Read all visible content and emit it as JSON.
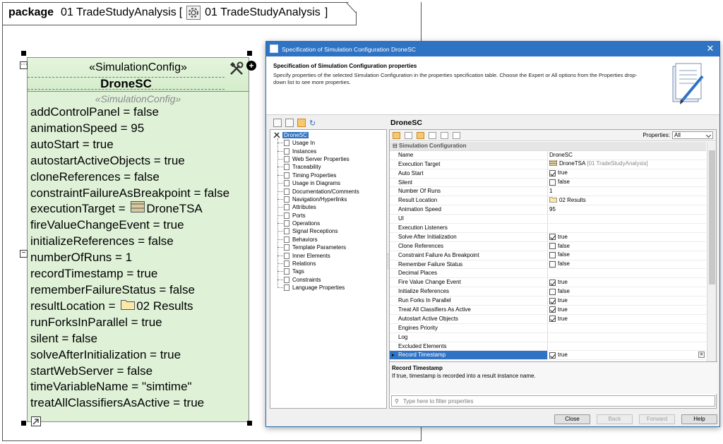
{
  "package": {
    "keyword": "package",
    "name": "01 TradeStudyAnalysis",
    "bracket_open": "[",
    "diagram_name": "01 TradeStudyAnalysis",
    "bracket_close": "]"
  },
  "block": {
    "stereotype": "«SimulationConfig»",
    "name": "DroneSC",
    "props_stereotype": "«SimulationConfig»",
    "properties": [
      {
        "text": "addControlPanel = false"
      },
      {
        "text": "animationSpeed = 95"
      },
      {
        "text": "autoStart = true"
      },
      {
        "text": "autostartActiveObjects = true"
      },
      {
        "text": "cloneReferences = false"
      },
      {
        "text": "constraintFailureAsBreakpoint = false"
      },
      {
        "text": "executionTarget = ",
        "icon": "block-icon",
        "icon_text": "DroneTSA"
      },
      {
        "text": "fireValueChangeEvent = true"
      },
      {
        "text": "initializeReferences = false"
      },
      {
        "text": "numberOfRuns = 1"
      },
      {
        "text": "recordTimestamp = true"
      },
      {
        "text": "rememberFailureStatus = false"
      },
      {
        "text": "resultLocation = ",
        "icon": "folder-icon",
        "icon_text": "02 Results"
      },
      {
        "text": "runForksInParallel = true"
      },
      {
        "text": "silent = false"
      },
      {
        "text": "solveAfterInitialization = true"
      },
      {
        "text": "startWebServer = false"
      },
      {
        "text": "timeVariableName = \"simtime\""
      },
      {
        "text": "treatAllClassifiersAsActive = true"
      }
    ]
  },
  "dialog": {
    "title": "Specification of Simulation Configuration DroneSC",
    "close_glyph": "✕",
    "header_title": "Specification of Simulation Configuration properties",
    "header_desc": "Specify properties of the selected Simulation Configuration in the properties specification table. Choose the Expert or All options from the Properties drop-down list to see more properties.",
    "tree_root": "DroneSC",
    "tree_items": [
      "Usage In",
      "Instances",
      "Web Server Properties",
      "Traceability",
      "Timing Properties",
      "Usage in Diagrams",
      "Documentation/Comments",
      "Navigation/Hyperlinks",
      "Attributes",
      "Ports",
      "Operations",
      "Signal Receptions",
      "Behaviors",
      "Template Parameters",
      "Inner Elements",
      "Relations",
      "Tags",
      "Constraints",
      "Language Properties"
    ],
    "element_name": "DroneSC",
    "properties_label": "Properties:",
    "properties_filter": "All",
    "group": "Simulation Configuration",
    "rows": [
      {
        "name": "Name",
        "value": "DroneSC"
      },
      {
        "name": "Execution Target",
        "value": "DroneTSA",
        "icon": "block-icon",
        "extra": "[01 TradeStudyAnalysis]"
      },
      {
        "name": "Auto Start",
        "value": "true",
        "checkbox": true,
        "checked": true
      },
      {
        "name": "Silent",
        "value": "false",
        "checkbox": true,
        "checked": false
      },
      {
        "name": "Number Of Runs",
        "value": "1"
      },
      {
        "name": "Result Location",
        "value": "02 Results",
        "icon": "folder-icon"
      },
      {
        "name": "Animation Speed",
        "value": "95"
      },
      {
        "name": "UI",
        "value": ""
      },
      {
        "name": "Execution Listeners",
        "value": ""
      },
      {
        "name": "Solve After Initialization",
        "value": "true",
        "checkbox": true,
        "checked": true
      },
      {
        "name": "Clone References",
        "value": "false",
        "checkbox": true,
        "checked": false
      },
      {
        "name": "Constraint Failure As Breakpoint",
        "value": "false",
        "checkbox": true,
        "checked": false
      },
      {
        "name": "Remember Failure Status",
        "value": "false",
        "checkbox": true,
        "checked": false
      },
      {
        "name": "Decimal Places",
        "value": ""
      },
      {
        "name": "Fire Value Change Event",
        "value": "true",
        "checkbox": true,
        "checked": true
      },
      {
        "name": "Initialize References",
        "value": "false",
        "checkbox": true,
        "checked": false
      },
      {
        "name": "Run Forks In Parallel",
        "value": "true",
        "checkbox": true,
        "checked": true
      },
      {
        "name": "Treat All Classifiers As Active",
        "value": "true",
        "checkbox": true,
        "checked": true
      },
      {
        "name": "Autostart Active Objects",
        "value": "true",
        "checkbox": true,
        "checked": true
      },
      {
        "name": "Engines Priority",
        "value": ""
      },
      {
        "name": "Log",
        "value": ""
      },
      {
        "name": "Excluded Elements",
        "value": ""
      },
      {
        "name": "Record Timestamp",
        "value": "true",
        "checkbox": true,
        "checked": true,
        "selected": true
      }
    ],
    "desc_title": "Record Timestamp",
    "desc_text": "If true, timestamp is recorded into a result instance name.",
    "filter_placeholder": "Type here to filter properties",
    "buttons": {
      "close": "Close",
      "back": "Back",
      "forward": "Forward",
      "help": "Help"
    }
  }
}
